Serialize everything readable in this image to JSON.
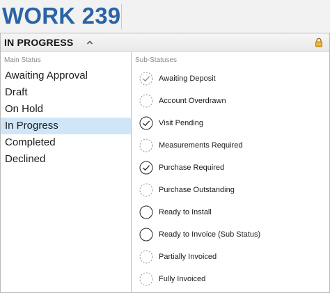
{
  "header": {
    "title": "WORK 239"
  },
  "panel": {
    "status_title": "IN PROGRESS",
    "main_heading": "Main Status",
    "sub_heading": "Sub-Statuses",
    "main_statuses": [
      {
        "label": "Awaiting Approval",
        "selected": false
      },
      {
        "label": "Draft",
        "selected": false
      },
      {
        "label": "On Hold",
        "selected": false
      },
      {
        "label": "In Progress",
        "selected": true
      },
      {
        "label": "Completed",
        "selected": false
      },
      {
        "label": "Declined",
        "selected": false
      }
    ],
    "sub_statuses": [
      {
        "label": "Awaiting Deposit",
        "state": "dashed-check"
      },
      {
        "label": "Account Overdrawn",
        "state": "dashed"
      },
      {
        "label": "Visit Pending",
        "state": "solid-check"
      },
      {
        "label": "Measurements Required",
        "state": "dashed"
      },
      {
        "label": "Purchase Required",
        "state": "solid-check"
      },
      {
        "label": "Purchase Outstanding",
        "state": "dashed"
      },
      {
        "label": "Ready to Install",
        "state": "solid"
      },
      {
        "label": "Ready to Invoice (Sub Status)",
        "state": "solid"
      },
      {
        "label": "Partially Invoiced",
        "state": "dashed"
      },
      {
        "label": "Fully Invoiced",
        "state": "dashed"
      }
    ]
  },
  "icons": {
    "collapse": "chevron-up-icon",
    "lock": "lock-icon"
  },
  "colors": {
    "title": "#2a64a6",
    "selected_row": "#cfe6f8",
    "lock": "#e8a317"
  }
}
